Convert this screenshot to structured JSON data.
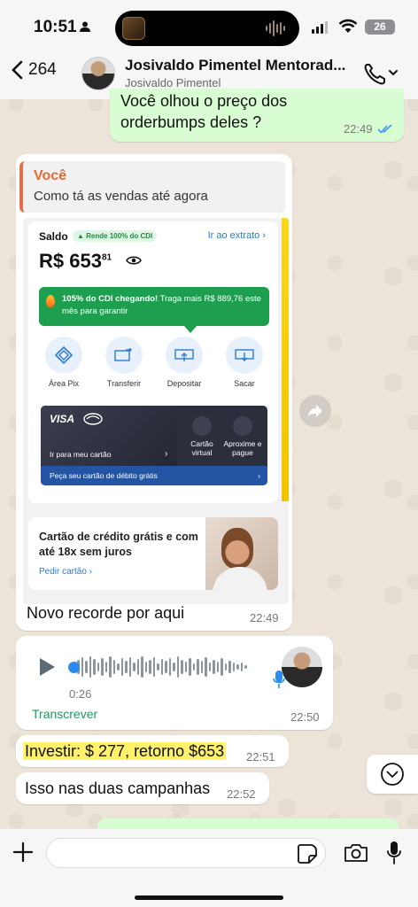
{
  "status_bar": {
    "time": "10:51",
    "battery": "26"
  },
  "header": {
    "back_count": "264",
    "contact_name": "Josivaldo Pimentel Mentorad...",
    "contact_sub": "Josivaldo Pimentel"
  },
  "messages": {
    "m1": {
      "text": "Você olhou o preço dos orderbumps deles ?",
      "time": "22:49"
    },
    "m2": {
      "quote_author": "Você",
      "quote_text": "Como tá as vendas até agora",
      "caption": "Novo recorde por aqui",
      "time": "22:49"
    },
    "voice": {
      "duration": "0:26",
      "transcribe": "Transcrever",
      "time": "22:50"
    },
    "m4": {
      "text": "Investir: $ 277, retorno $653",
      "time": "22:51"
    },
    "m5": {
      "text": "Isso nas duas campanhas",
      "time": "22:52"
    }
  },
  "bank_screenshot": {
    "saldo_label": "Saldo",
    "cdi_pill": "▲ Rende 100% do CDI",
    "extrato_link": "Ir ao extrato",
    "amount": "R$ 653",
    "amount_cents": "81",
    "promo_bold": "105% do CDI chegando!",
    "promo_rest": "Traga mais R$ 889,76 este mês para garantir",
    "actions": [
      "Área Pix",
      "Transferir",
      "Depositar",
      "Sacar"
    ],
    "card_brand": "VISA",
    "card_go": "Ir para meu cartão",
    "card_virtual": "Cartão virtual",
    "card_contactless": "Aproxime e pague",
    "card_strip": "Peça seu cartão de débito grátis",
    "credit_title": "Cartão de crédito grátis e com até 18x sem juros",
    "credit_link": "Pedir cartão"
  },
  "input": {
    "placeholder": ""
  }
}
